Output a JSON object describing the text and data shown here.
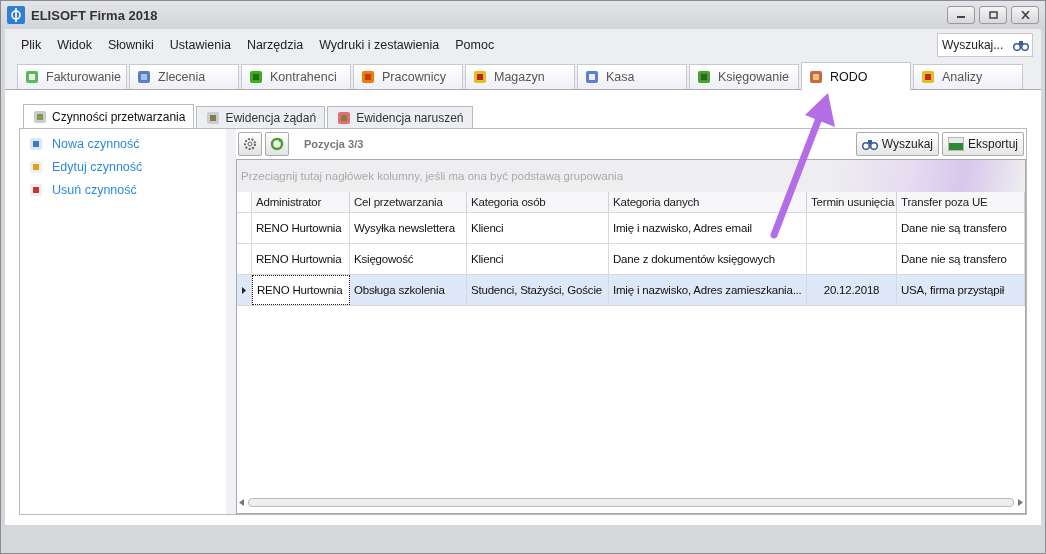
{
  "window": {
    "title": "ELISOFT Firma 2018"
  },
  "menu": [
    "Plik",
    "Widok",
    "Słowniki",
    "Ustawienia",
    "Narzędzia",
    "Wydruki i zestawienia",
    "Pomoc"
  ],
  "search": {
    "placeholder": "Wyszukaj..."
  },
  "main_tabs": [
    {
      "label": "Fakturowanie",
      "selected": false
    },
    {
      "label": "Zlecenia",
      "selected": false
    },
    {
      "label": "Kontrahenci",
      "selected": false
    },
    {
      "label": "Pracownicy",
      "selected": false
    },
    {
      "label": "Magazyn",
      "selected": false
    },
    {
      "label": "Kasa",
      "selected": false
    },
    {
      "label": "Księgowanie",
      "selected": false
    },
    {
      "label": "RODO",
      "selected": true
    },
    {
      "label": "Analizy",
      "selected": false
    }
  ],
  "sub_tabs": [
    {
      "label": "Czynności przetwarzania",
      "selected": true
    },
    {
      "label": "Ewidencja żądań",
      "selected": false
    },
    {
      "label": "Ewidencja naruszeń",
      "selected": false
    }
  ],
  "actions": [
    {
      "label": "Nowa czynność"
    },
    {
      "label": "Edytuj czynność"
    },
    {
      "label": "Usuń czynność"
    }
  ],
  "toolbar": {
    "position": "Pozycja 3/3",
    "buttons": [
      "Wyszukaj",
      "Eksportuj"
    ]
  },
  "group_panel_hint": "Przeciągnij tutaj nagłówek kolumny, jeśli ma ona być podstawą grupowania",
  "table": {
    "columns": [
      "Administrator",
      "Cel przetwarzania",
      "Kategoria osób",
      "Kategoria danych",
      "Termin usunięcia",
      "Transfer poza UE"
    ],
    "rows": [
      {
        "cells": [
          "RENO Hurtownia",
          "Wysyłka newslettera",
          "Klienci",
          "Imię i nazwisko, Adres email",
          "",
          "Dane nie są transfero"
        ],
        "selected": false
      },
      {
        "cells": [
          "RENO Hurtownia",
          "Księgowość",
          "Klienci",
          "Dane z dokumentów księgowych",
          "",
          "Dane nie są transfero"
        ],
        "selected": false
      },
      {
        "cells": [
          "RENO Hurtownia",
          "Obsługa szkolenia",
          "Studenci, Stażyści, Goście",
          "Imię i nazwisko, Adres zamieszkania...",
          "20.12.2018",
          "USA, firma przystąpił"
        ],
        "selected": true
      }
    ]
  }
}
